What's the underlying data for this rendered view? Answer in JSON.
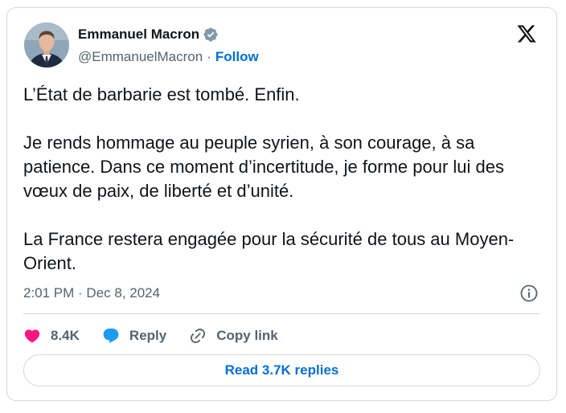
{
  "author": {
    "display_name": "Emmanuel Macron",
    "handle": "@EmmanuelMacron",
    "separator": "·",
    "follow_label": "Follow",
    "avatar_icon": "person-avatar"
  },
  "tweet": {
    "paragraphs": [
      "L’État de barbarie est tombé. Enfin.",
      "Je rends hommage au peuple syrien, à son courage, à sa patience. Dans ce moment d’incertitude, je forme pour lui des vœux de paix, de liberté et d’unité.",
      "La France restera engagée pour la sécurité de tous au Moyen-Orient."
    ],
    "timestamp": "2:01 PM · Dec 8, 2024"
  },
  "actions": {
    "like_count": "8.4K",
    "reply_label": "Reply",
    "copy_link_label": "Copy link"
  },
  "footer": {
    "read_replies_label": "Read 3.7K replies"
  },
  "colors": {
    "text": "#0f1419",
    "secondary": "#536471",
    "link": "#006fd6",
    "like": "#f91880",
    "reply": "#1d9bf0",
    "verified": "#829aab",
    "border": "#cfd9de"
  }
}
